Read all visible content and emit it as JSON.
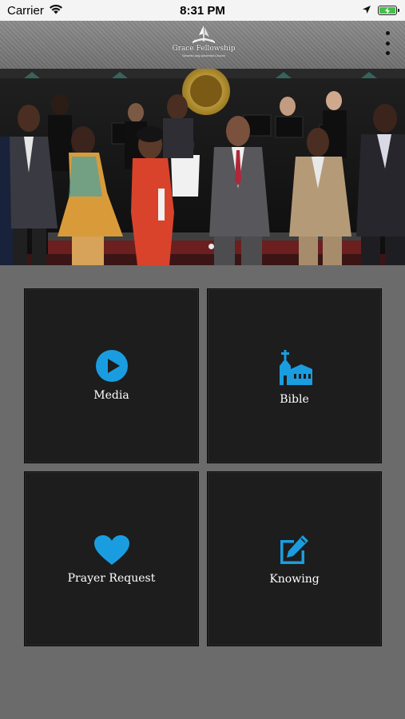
{
  "status_bar": {
    "carrier": "Carrier",
    "time": "8:31 PM",
    "battery_color": "#43c04a"
  },
  "header": {
    "logo_text": "Grace Fellowship",
    "logo_subtext": "Seventh-day Adventist Church",
    "menu_icon": "more-vertical-icon"
  },
  "carousel": {
    "image_description_icon": "church-choir-photo",
    "page_count": 2,
    "active_page": 1
  },
  "tiles": [
    {
      "label": "Media",
      "icon": "play-circle-icon"
    },
    {
      "label": "Bible",
      "icon": "church-icon"
    },
    {
      "label": "Prayer Request",
      "icon": "heart-icon"
    },
    {
      "label": "Knowing",
      "icon": "edit-icon"
    }
  ],
  "colors": {
    "accent": "#1a9de0",
    "background": "#6b6b6b",
    "tile": "#1d1d1d"
  }
}
